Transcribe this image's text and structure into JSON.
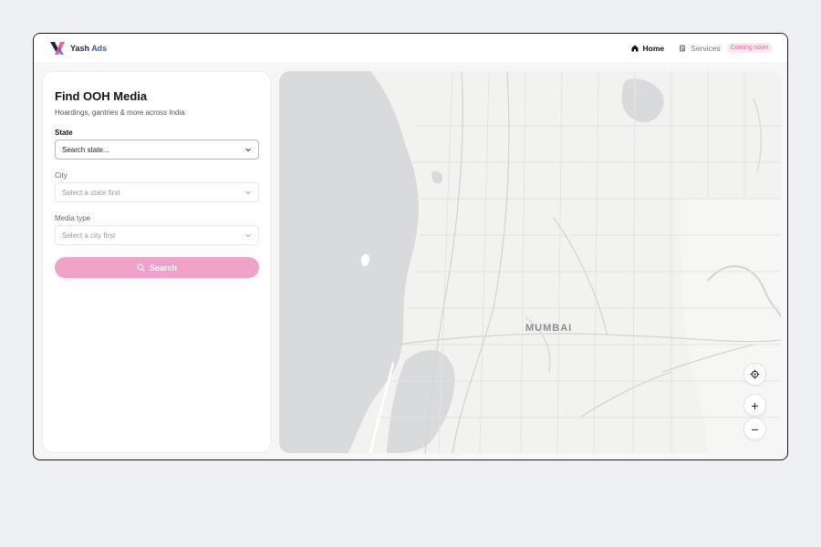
{
  "brand": {
    "name_first": "Yash",
    "name_second": "Ads"
  },
  "nav": {
    "home_label": "Home",
    "services_label": "Services",
    "services_badge": "Coming soon"
  },
  "panel": {
    "title": "Find OOH Media",
    "subtitle": "Hoardings, gantries & more across India",
    "state_label": "State",
    "state_value": "Search state...",
    "city_label": "City",
    "city_value": "Select a state first",
    "media_label": "Media type",
    "media_value": "Select a city first",
    "search_label": "Search"
  },
  "map": {
    "city_label": "MUMBAI",
    "zoom_in": "+",
    "zoom_out": "−"
  },
  "colors": {
    "accent_pink": "#f0a2c8",
    "badge_text": "#e4669a",
    "brand_navy": "#1f2245",
    "water": "#d9dadc"
  }
}
